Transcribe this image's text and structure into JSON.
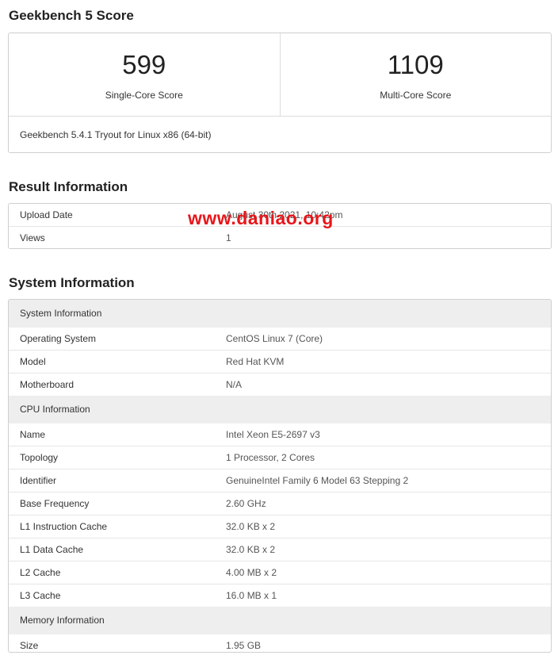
{
  "score_section": {
    "title": "Geekbench 5 Score",
    "single_core_value": "599",
    "single_core_label": "Single-Core Score",
    "multi_core_value": "1109",
    "multi_core_label": "Multi-Core Score",
    "version": "Geekbench 5.4.1 Tryout for Linux x86 (64-bit)"
  },
  "result_section": {
    "title": "Result Information",
    "rows": [
      {
        "key": "Upload Date",
        "value": "August 30th 2021, 10:42pm"
      },
      {
        "key": "Views",
        "value": "1"
      }
    ]
  },
  "system_section": {
    "title": "System Information",
    "groups": [
      {
        "header": "System Information",
        "rows": [
          {
            "key": "Operating System",
            "value": "CentOS Linux 7 (Core)"
          },
          {
            "key": "Model",
            "value": "Red Hat KVM"
          },
          {
            "key": "Motherboard",
            "value": "N/A"
          }
        ]
      },
      {
        "header": "CPU Information",
        "rows": [
          {
            "key": "Name",
            "value": "Intel Xeon E5-2697 v3"
          },
          {
            "key": "Topology",
            "value": "1 Processor, 2 Cores"
          },
          {
            "key": "Identifier",
            "value": "GenuineIntel Family 6 Model 63 Stepping 2"
          },
          {
            "key": "Base Frequency",
            "value": "2.60 GHz"
          },
          {
            "key": "L1 Instruction Cache",
            "value": "32.0 KB x 2"
          },
          {
            "key": "L1 Data Cache",
            "value": "32.0 KB x 2"
          },
          {
            "key": "L2 Cache",
            "value": "4.00 MB x 2"
          },
          {
            "key": "L3 Cache",
            "value": "16.0 MB x 1"
          }
        ]
      },
      {
        "header": "Memory Information",
        "rows": [
          {
            "key": "Size",
            "value": "1.95 GB"
          }
        ]
      }
    ]
  },
  "watermark": {
    "text": "www.daniao.org",
    "color": "#e8161a"
  }
}
